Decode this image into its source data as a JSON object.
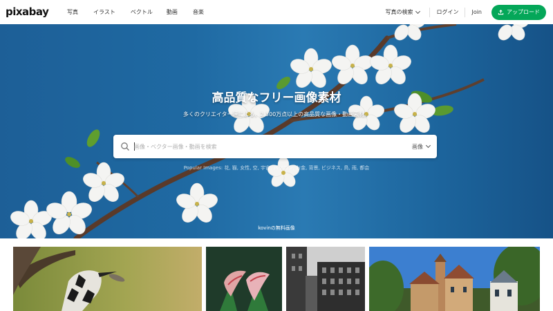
{
  "brand": {
    "logo": "pixabay",
    "accent": "#04a759"
  },
  "nav": [
    "写真",
    "イラスト",
    "ベクトル",
    "動画",
    "音楽"
  ],
  "header_right": {
    "explore": "写真の検索",
    "login": "ログイン",
    "join": "Join",
    "upload": "アップロード"
  },
  "hero": {
    "title": "高品質なフリー画像素材",
    "subtitle": "多くのクリエイター達による、2,300万点以上の高品質な画像・動画素材。",
    "search_placeholder": "画像・ベクター画像・動画を検索",
    "search_type": "画像",
    "popular": "Popular Images: 花, 猫, 女性, 空, 宇宙, パソコン, お金, 背景, ビジネス, 鳥, 雨, 都会",
    "credit": "kovinの無料画像"
  },
  "icons": {
    "search": "search-icon",
    "upload": "upload-icon",
    "chevron": "chevron-down-icon"
  },
  "thumbnails": [
    {
      "name": "bird-photo"
    },
    {
      "name": "calla-lily-photo"
    },
    {
      "name": "bw-building-photo"
    },
    {
      "name": "town-tower-photo"
    }
  ]
}
